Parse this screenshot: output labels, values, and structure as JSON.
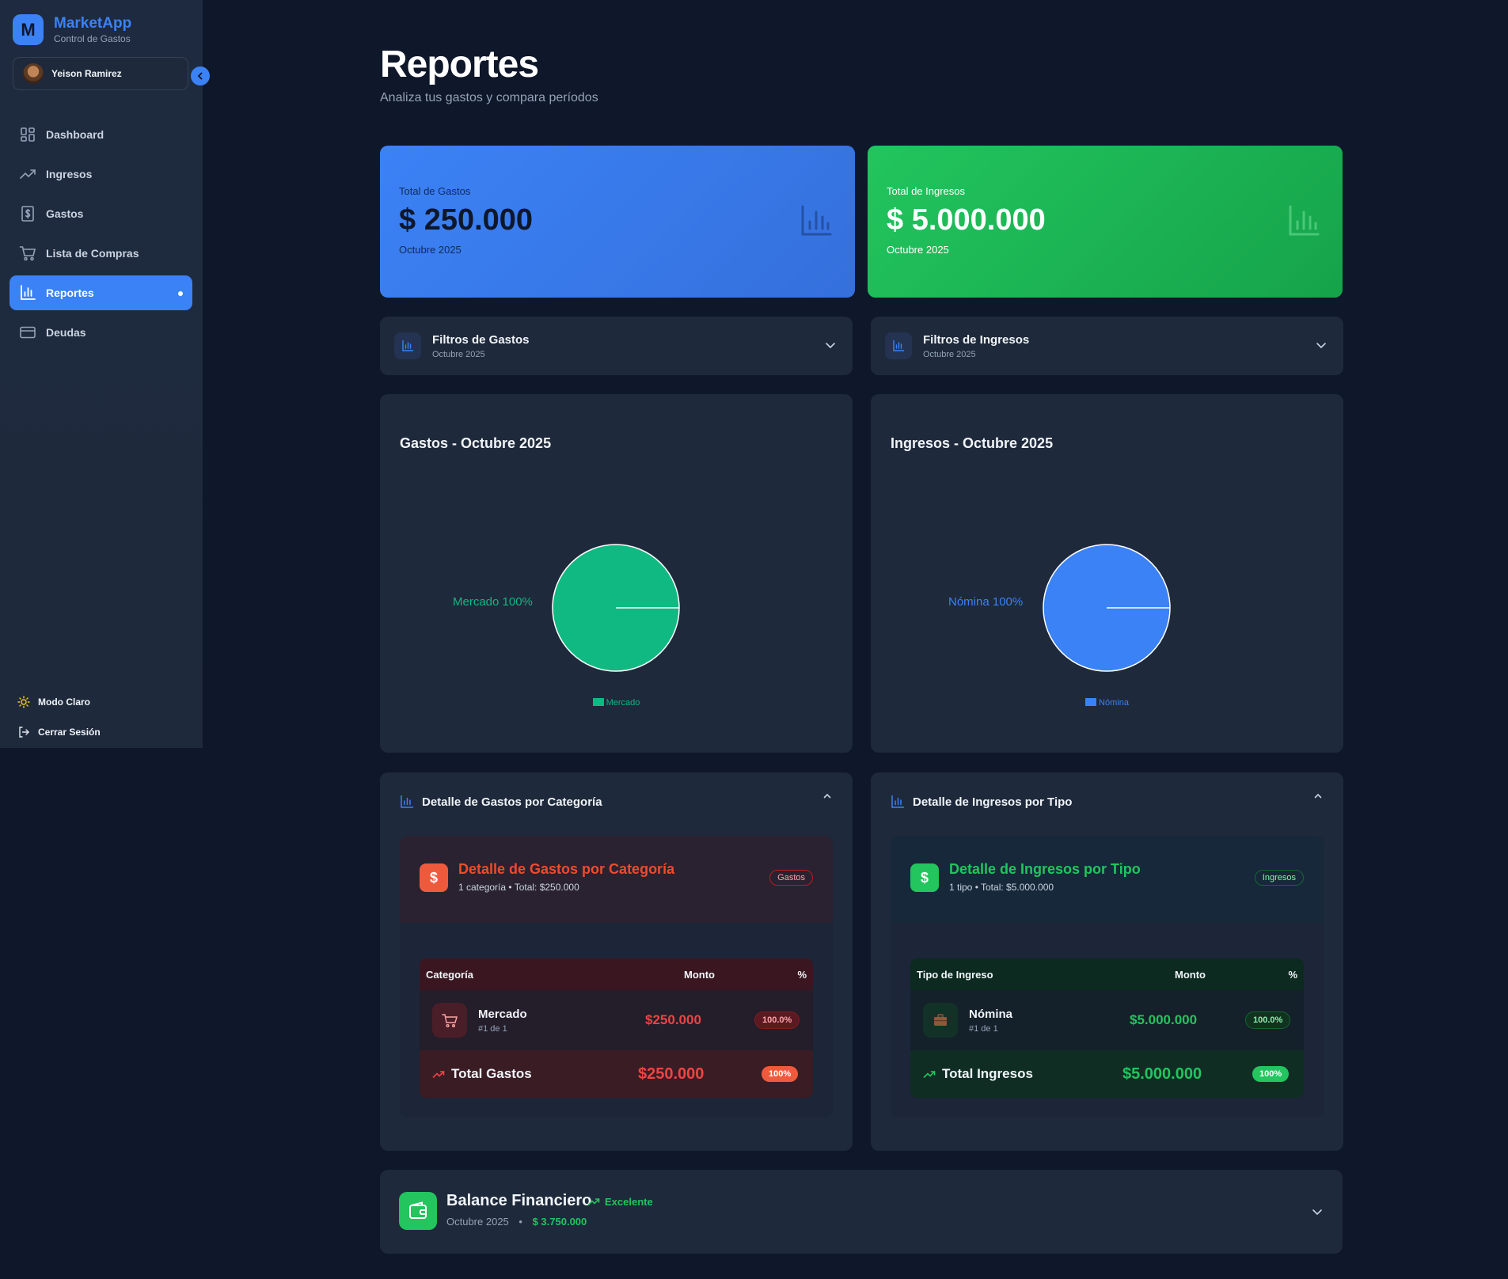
{
  "app": {
    "name": "MarketApp",
    "subtitle": "Control de Gastos",
    "logo_letter": "M"
  },
  "user": {
    "name": "Yeison Ramirez"
  },
  "nav": [
    {
      "label": "Dashboard",
      "icon": "dashboard-icon"
    },
    {
      "label": "Ingresos",
      "icon": "trending-up-icon"
    },
    {
      "label": "Gastos",
      "icon": "receipt-icon"
    },
    {
      "label": "Lista de Compras",
      "icon": "cart-icon"
    },
    {
      "label": "Reportes",
      "icon": "bar-chart-icon",
      "active": true
    },
    {
      "label": "Deudas",
      "icon": "credit-card-icon"
    }
  ],
  "sidebar_bottom": {
    "theme_label": "Modo Claro",
    "logout_label": "Cerrar Sesión"
  },
  "page": {
    "title": "Reportes",
    "subtitle": "Analiza tus gastos y compara períodos"
  },
  "stats": {
    "gastos": {
      "label": "Total de Gastos",
      "value": "$ 250.000",
      "period": "Octubre 2025"
    },
    "ingresos": {
      "label": "Total de Ingresos",
      "value": "$ 5.000.000",
      "period": "Octubre 2025"
    }
  },
  "filters": {
    "gastos": {
      "title": "Filtros de Gastos",
      "period": "Octubre 2025"
    },
    "ingresos": {
      "title": "Filtros de Ingresos",
      "period": "Octubre 2025"
    }
  },
  "chart_data": [
    {
      "type": "pie",
      "title": "Gastos - Octubre 2025",
      "categories": [
        "Mercado"
      ],
      "values": [
        100
      ],
      "slice_labels": [
        "Mercado 100%"
      ],
      "legend": [
        "Mercado"
      ],
      "colors": [
        "#10b981"
      ]
    },
    {
      "type": "pie",
      "title": "Ingresos - Octubre 2025",
      "categories": [
        "Nómina"
      ],
      "values": [
        100
      ],
      "slice_labels": [
        "Nómina 100%"
      ],
      "legend": [
        "Nómina"
      ],
      "colors": [
        "#3b82f6"
      ]
    }
  ],
  "details": {
    "gastos": {
      "header": "Detalle de Gastos por Categoría",
      "title": "Detalle de Gastos por Categoría",
      "summary": "1 categoría • Total: $250.000",
      "badge": "Gastos",
      "columns": [
        "Categoría",
        "Monto",
        "%"
      ],
      "rows": [
        {
          "name": "Mercado",
          "rank": "#1 de 1",
          "amount": "$250.000",
          "pct": "100.0%"
        }
      ],
      "total": {
        "label": "Total Gastos",
        "amount": "$250.000",
        "pct": "100%"
      }
    },
    "ingresos": {
      "header": "Detalle de Ingresos por Tipo",
      "title": "Detalle de Ingresos por Tipo",
      "summary": "1 tipo • Total: $5.000.000",
      "badge": "Ingresos",
      "columns": [
        "Tipo de Ingreso",
        "Monto",
        "%"
      ],
      "rows": [
        {
          "name": "Nómina",
          "rank": "#1 de 1",
          "amount": "$5.000.000",
          "pct": "100.0%"
        }
      ],
      "total": {
        "label": "Total Ingresos",
        "amount": "$5.000.000",
        "pct": "100%"
      }
    }
  },
  "balance": {
    "title": "Balance Financiero",
    "status": "Excelente",
    "period": "Octubre 2025",
    "separator": "•",
    "amount": "$ 3.750.000"
  },
  "colors": {
    "accent": "#3b82f6",
    "success": "#22c55e",
    "danger": "#ef4444",
    "bg": "#0f172a",
    "card": "#1e293b"
  }
}
